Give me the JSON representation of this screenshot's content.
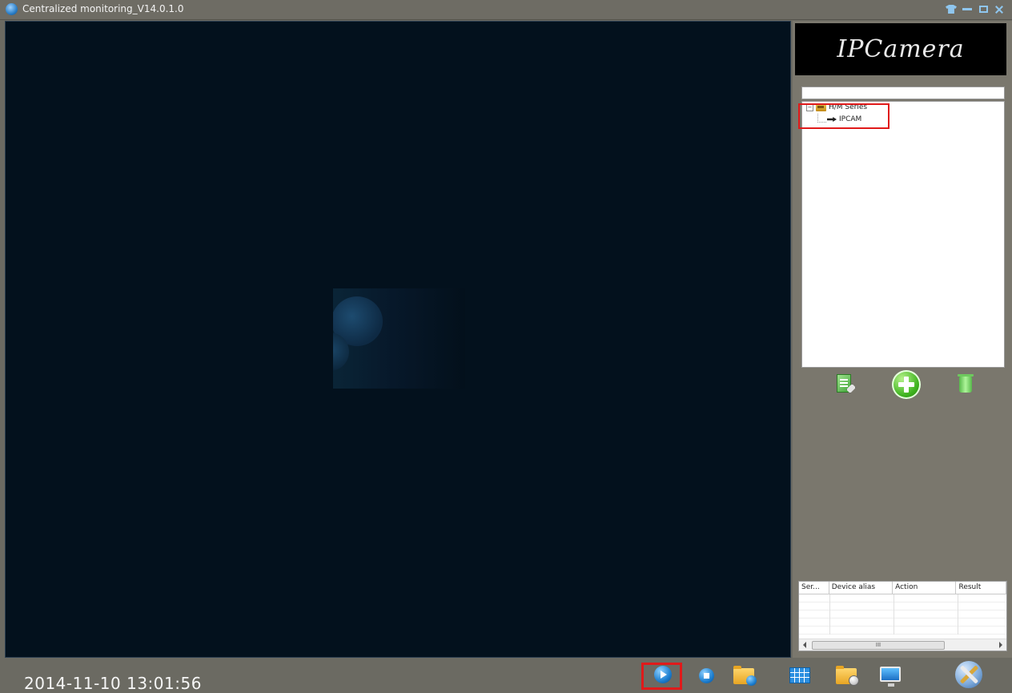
{
  "window": {
    "title": "Centralized monitoring_V14.0.1.0",
    "controls": [
      "skin-icon",
      "minimize-icon",
      "maximize-icon",
      "close-icon"
    ]
  },
  "logo": {
    "text": "IPCamera"
  },
  "device_search": {
    "value": ""
  },
  "device_tree": {
    "groups": [
      {
        "label": "H/M Series",
        "expanded": true,
        "icon": "folder-icon",
        "children": [
          {
            "label": "IPCAM",
            "icon": "camera-icon"
          }
        ]
      }
    ]
  },
  "device_actions": [
    "edit-device-icon",
    "add-device-icon",
    "delete-device-icon"
  ],
  "log_table": {
    "columns": [
      "Ser...",
      "Device alias",
      "Action",
      "Result"
    ],
    "rows": [],
    "scrollbar_thumb": "III"
  },
  "status": {
    "datetime": "2014-11-10 13:01:56"
  },
  "toolbar": [
    "play-icon",
    "stop-icon",
    "record-folder-icon",
    "split-screen-grid-icon",
    "schedule-folder-icon",
    "monitor-icon",
    "settings-tools-icon"
  ],
  "colors": {
    "video_bg": "#03111d",
    "panel_bg": "#7a776d",
    "highlight": "#e01a1a"
  }
}
